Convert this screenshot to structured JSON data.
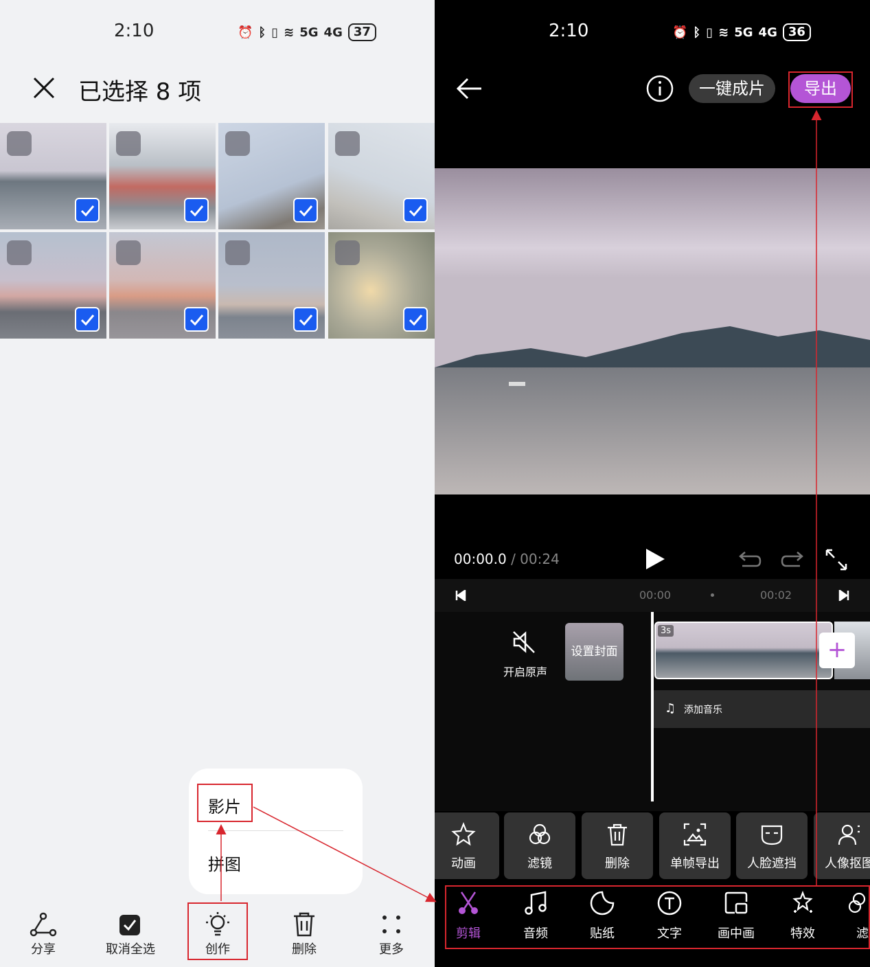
{
  "left": {
    "status": {
      "time": "2:10",
      "network_5g": "5G",
      "network_4g": "4G",
      "battery": "37"
    },
    "header": {
      "title": "已选择 8 项"
    },
    "photos": [
      {
        "selected": true
      },
      {
        "selected": true
      },
      {
        "selected": true
      },
      {
        "selected": true
      },
      {
        "selected": true
      },
      {
        "selected": true
      },
      {
        "selected": true
      },
      {
        "selected": true
      }
    ],
    "popup": {
      "items": [
        "影片",
        "拼图"
      ]
    },
    "bottom_bar": {
      "share": "分享",
      "deselect_all": "取消全选",
      "create": "创作",
      "delete": "删除",
      "more": "更多"
    }
  },
  "right": {
    "status": {
      "time": "2:10",
      "network_5g": "5G",
      "network_4g": "4G",
      "battery": "36"
    },
    "header": {
      "one_click": "一键成片",
      "export": "导出"
    },
    "player": {
      "current": "00:00.0",
      "separator": " / ",
      "total": "00:24"
    },
    "ruler": {
      "t0": "00:00",
      "t1": "00:02"
    },
    "timeline": {
      "mute_label": "开启原声",
      "cover_label": "设置封面",
      "clip_duration": "3s",
      "add_music": "添加音乐"
    },
    "tools": [
      "动画",
      "滤镜",
      "删除",
      "单帧导出",
      "人脸遮挡",
      "人像抠图"
    ],
    "nav": [
      "剪辑",
      "音频",
      "贴纸",
      "文字",
      "画中画",
      "特效",
      "滤"
    ]
  },
  "colors": {
    "accent_purple": "#b455d6",
    "annotation_red": "#d8262e",
    "check_blue": "#1a5cf0"
  }
}
